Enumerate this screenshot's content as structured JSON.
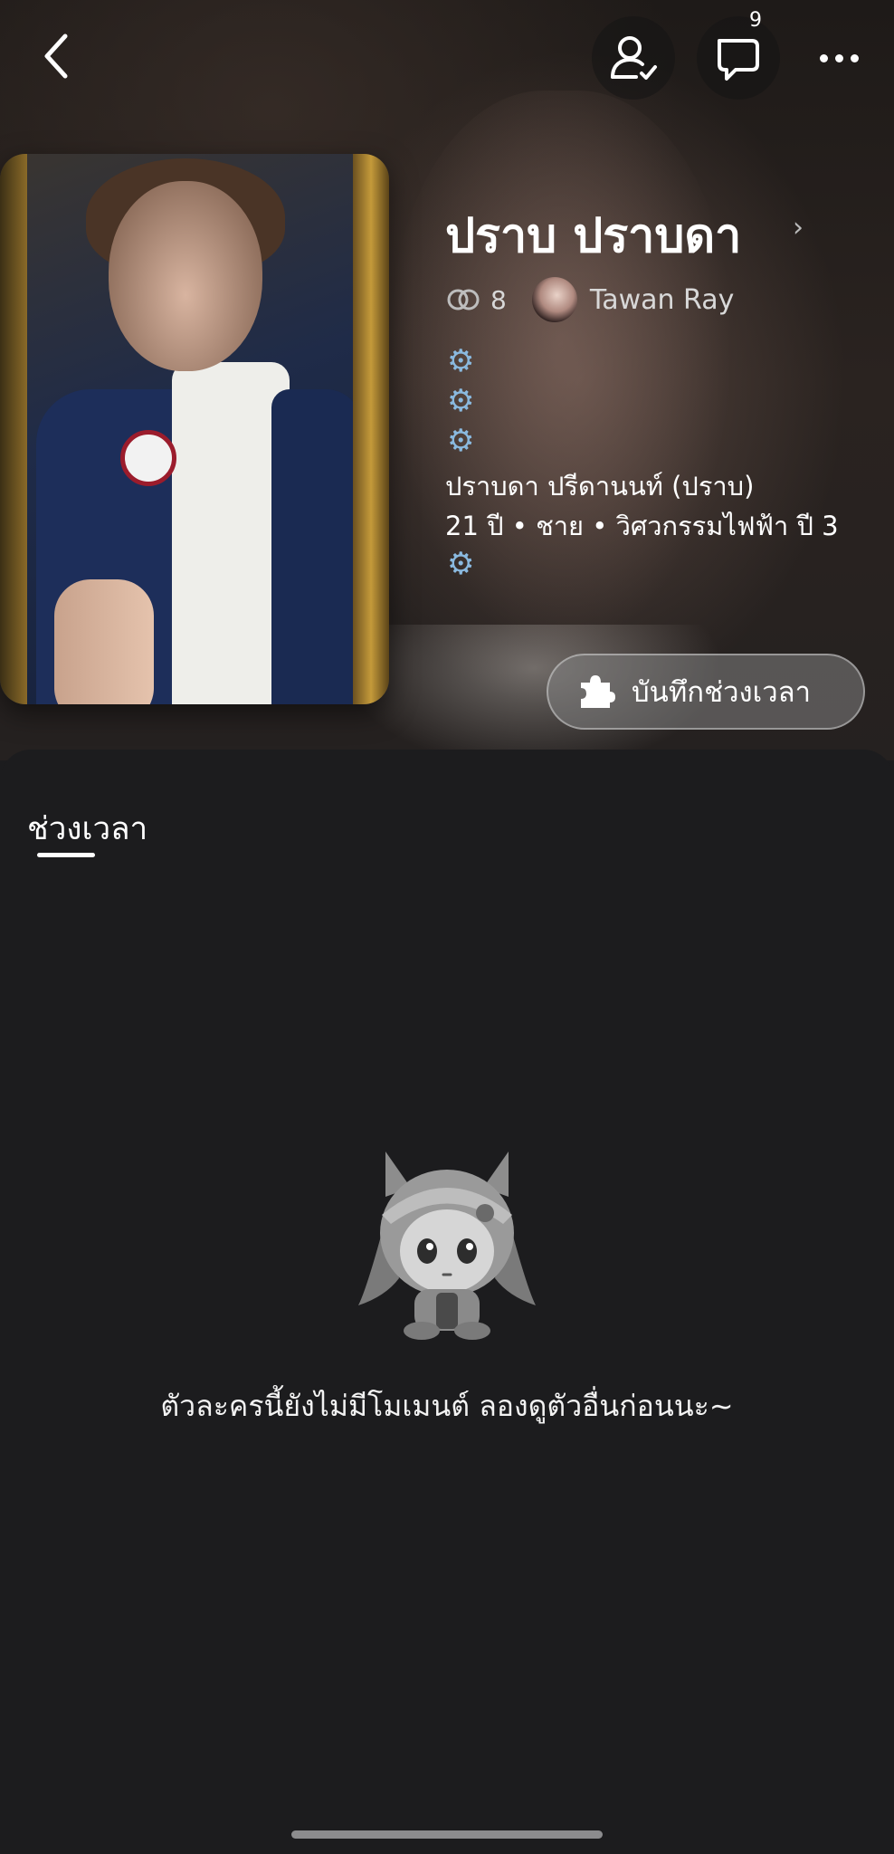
{
  "topbar": {
    "back_icon": "back-chevron-icon",
    "follow_icon": "user-check-icon",
    "chat_icon": "chat-bubble-icon",
    "chat_badge": "9",
    "more_icon": "more-horizontal-icon"
  },
  "character": {
    "name": "ปราบ ปราบดา",
    "link_count": "8",
    "creator_name": "Tawan Ray",
    "description": {
      "full_name": "ปราบดา ปรีดานนท์ (ปราบ)",
      "details": "21 ปี • ชาย • วิศวกรรมไฟฟ้า ปี 3"
    },
    "gear_glyph": "⚙"
  },
  "actions": {
    "record_moment_label": "บันทึกช่วงเวลา",
    "record_icon": "puzzle-piece-icon"
  },
  "tabs": [
    {
      "label": "ช่วงเวลา",
      "active": true
    }
  ],
  "empty_state": {
    "message": "ตัวละครนี้ยังไม่มีโมเมนต์ ลองดูตัวอื่นก่อนนะ~"
  },
  "colors": {
    "background": "#1c1c1e",
    "gear": "#8ab9df"
  }
}
